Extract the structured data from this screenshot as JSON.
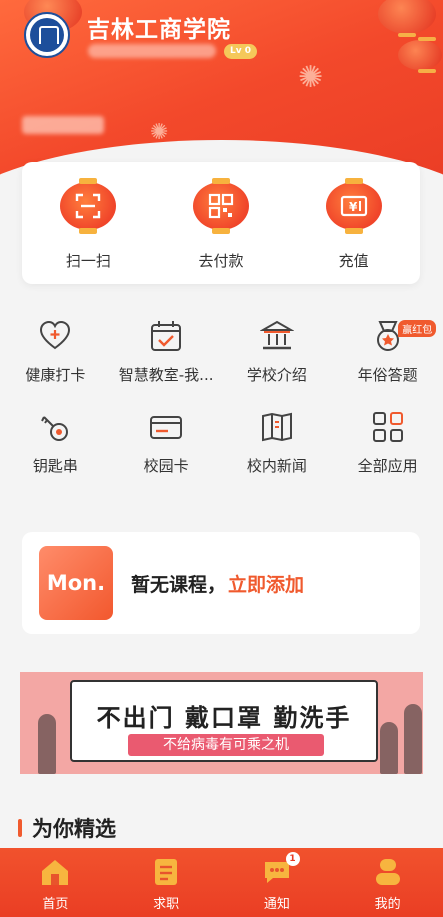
{
  "header": {
    "school_name": "吉林工商学院",
    "level_badge": "Lv 0"
  },
  "quick_actions": [
    {
      "label": "扫一扫",
      "icon": "scan-icon"
    },
    {
      "label": "去付款",
      "icon": "qr-code-icon"
    },
    {
      "label": "充值",
      "icon": "recharge-icon"
    }
  ],
  "apps": [
    {
      "label": "健康打卡",
      "icon": "heart-plus-icon"
    },
    {
      "label": "智慧教室-我...",
      "icon": "calendar-check-icon"
    },
    {
      "label": "学校介绍",
      "icon": "school-building-icon"
    },
    {
      "label": "年俗答题",
      "icon": "medal-icon",
      "tag": "赢红包"
    },
    {
      "label": "钥匙串",
      "icon": "key-icon"
    },
    {
      "label": "校园卡",
      "icon": "card-icon"
    },
    {
      "label": "校内新闻",
      "icon": "newspaper-icon"
    },
    {
      "label": "全部应用",
      "icon": "grid-icon"
    }
  ],
  "course": {
    "day": "Mon.",
    "empty_text": "暂无课程，",
    "add_link": "立即添加"
  },
  "banner": {
    "title": "不出门 戴口罩 勤洗手",
    "subtitle": "不给病毒有可乘之机"
  },
  "section": {
    "title": "为你精选"
  },
  "nav": [
    {
      "label": "首页",
      "icon": "home-icon",
      "active": true
    },
    {
      "label": "求职",
      "icon": "resume-icon"
    },
    {
      "label": "通知",
      "icon": "message-icon",
      "badge": "1"
    },
    {
      "label": "我的",
      "icon": "profile-icon"
    }
  ],
  "colors": {
    "brand": "#f05a2e",
    "header_top": "#ff6a3d",
    "header_bottom": "#e83a24",
    "banner_bg": "#f3a7a4"
  }
}
